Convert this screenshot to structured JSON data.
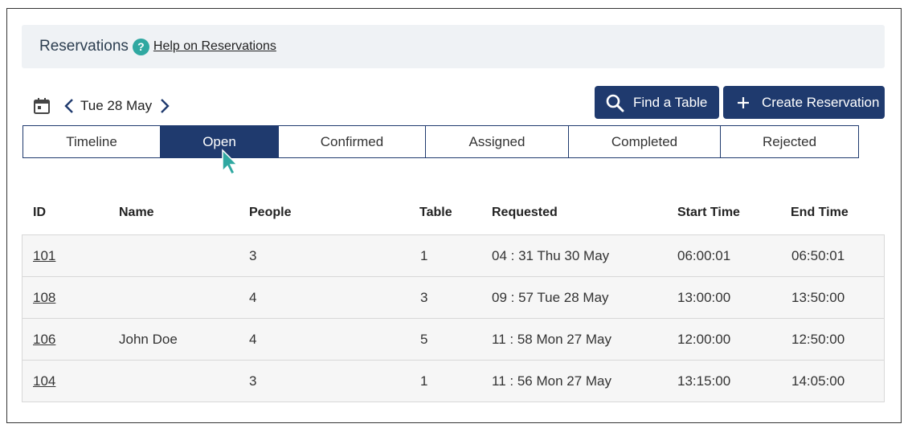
{
  "header": {
    "title": "Reservations",
    "help_icon": "?",
    "help_link": "Help on Reservations"
  },
  "date_nav": {
    "date": "Tue 28 May",
    "calendar_icon": "calendar-icon",
    "prev_icon": "chevron-left-icon",
    "next_icon": "chevron-right-icon"
  },
  "actions": {
    "find_table": "Find a Table",
    "create_reservation": "Create Reservation"
  },
  "tabs": [
    {
      "label": "Timeline",
      "active": false
    },
    {
      "label": "Open",
      "active": true
    },
    {
      "label": "Confirmed",
      "active": false
    },
    {
      "label": "Assigned",
      "active": false
    },
    {
      "label": "Completed",
      "active": false
    },
    {
      "label": "Rejected",
      "active": false
    }
  ],
  "table": {
    "columns": [
      "ID",
      "Name",
      "People",
      "Table",
      "Requested",
      "Start Time",
      "End Time"
    ],
    "rows": [
      {
        "id": "101",
        "name": "",
        "people": "3",
        "table": "1",
        "requested": "04 : 31 Thu 30 May",
        "start": "06:00:01",
        "end": "06:50:01"
      },
      {
        "id": "108",
        "name": "",
        "people": "4",
        "table": "3",
        "requested": "09 : 57 Tue 28 May",
        "start": "13:00:00",
        "end": "13:50:00"
      },
      {
        "id": "106",
        "name": "John Doe",
        "people": "4",
        "table": "5",
        "requested": "11 : 58 Mon 27 May",
        "start": "12:00:00",
        "end": "12:50:00"
      },
      {
        "id": "104",
        "name": "",
        "people": "3",
        "table": "1",
        "requested": "11 : 56 Mon 27 May",
        "start": "13:15:00",
        "end": "14:05:00"
      }
    ]
  },
  "colors": {
    "primary": "#1f3a6e",
    "accent": "#2fa8a1",
    "header_bg": "#eff2f5",
    "row_bg": "#f6f6f6"
  }
}
